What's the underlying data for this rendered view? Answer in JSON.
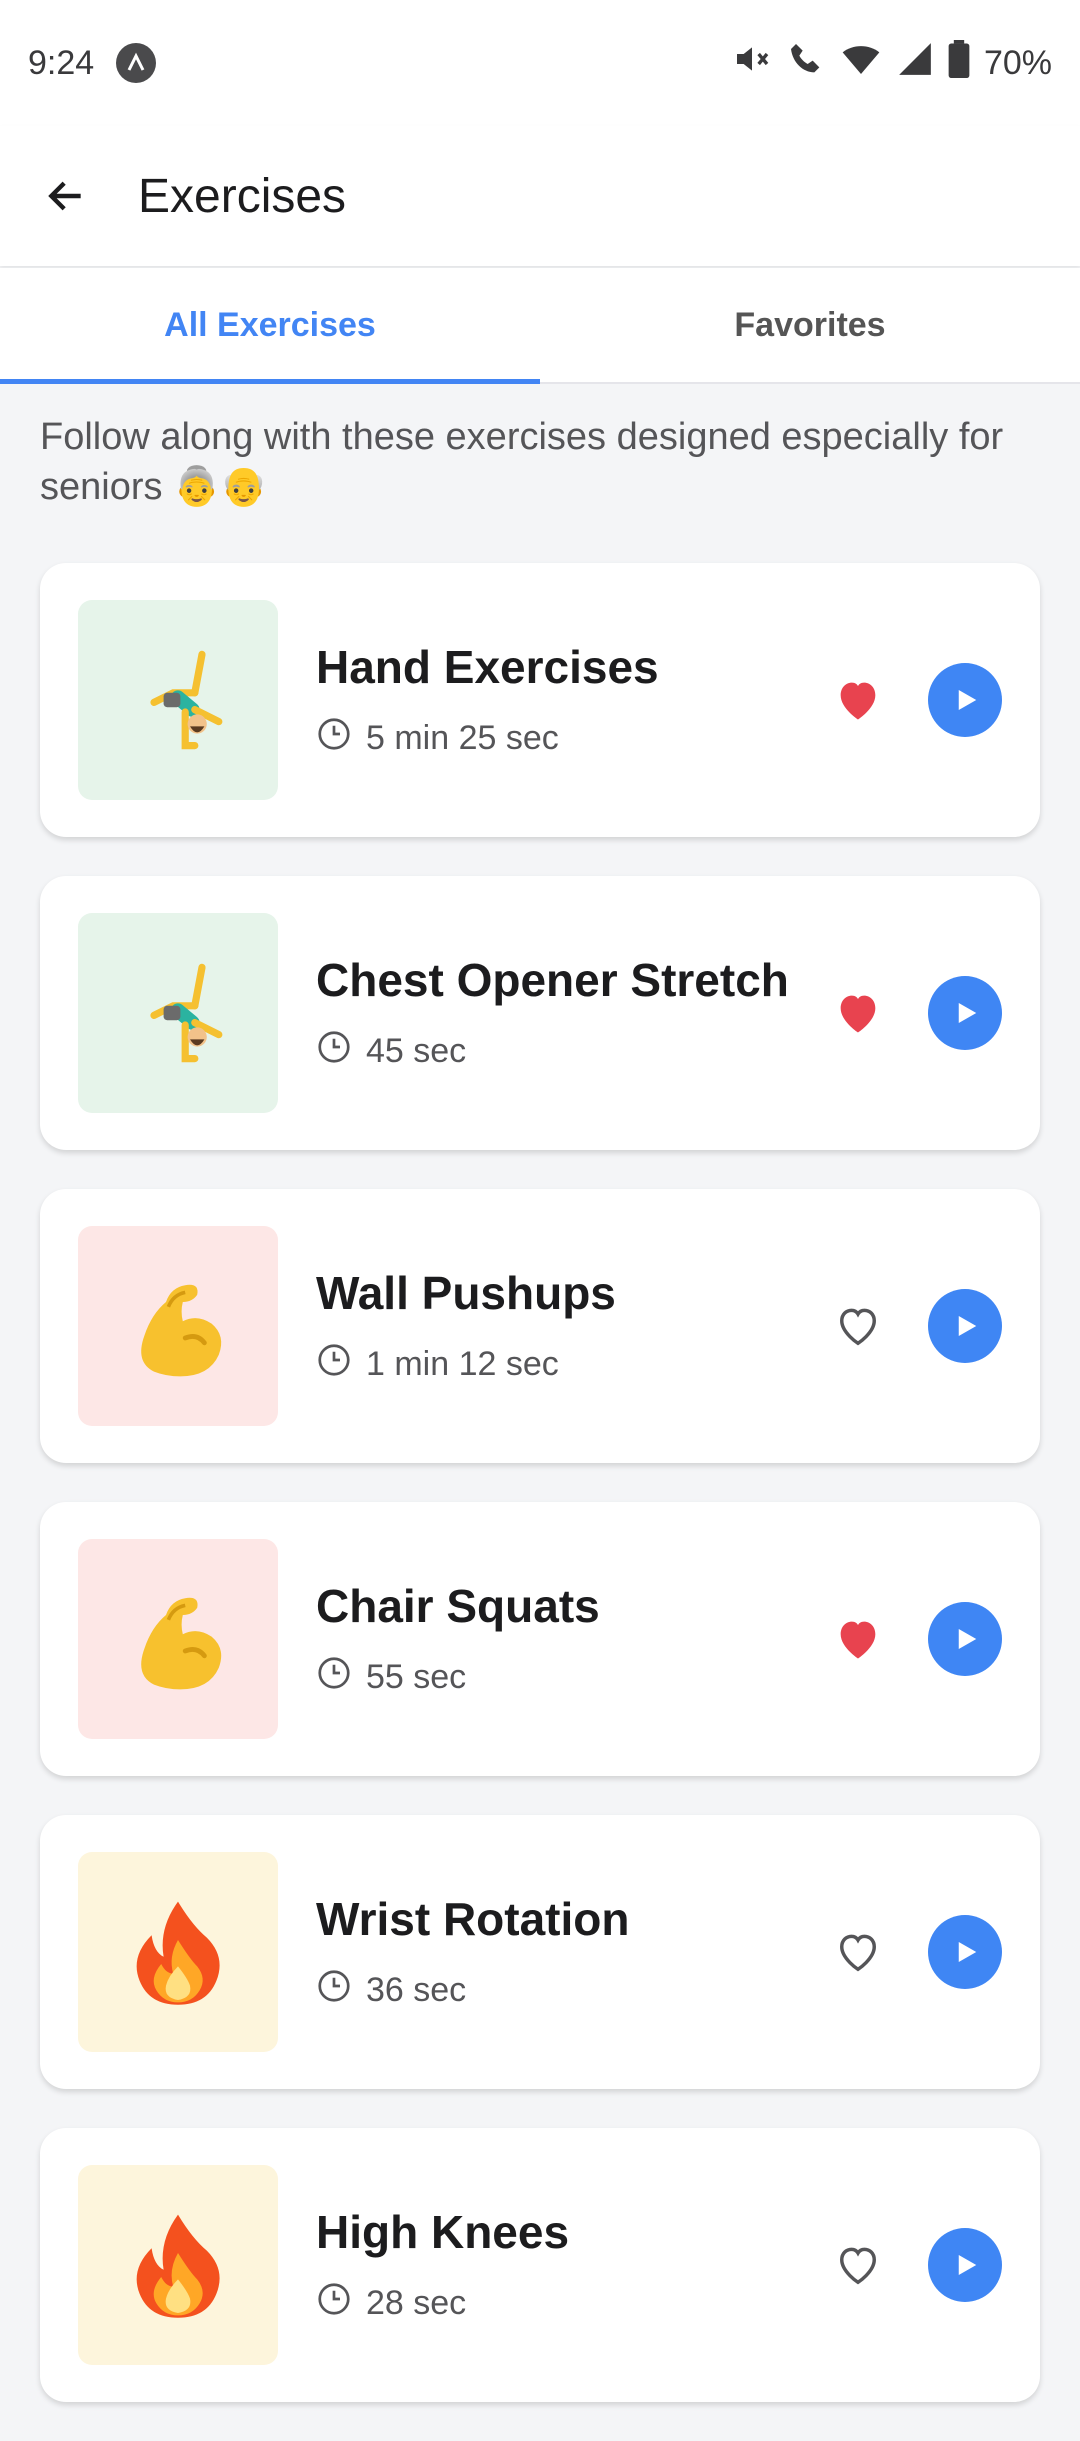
{
  "status_bar": {
    "time": "9:24",
    "battery": "70%"
  },
  "app_bar": {
    "title": "Exercises"
  },
  "tabs": [
    {
      "label": "All Exercises",
      "active": true
    },
    {
      "label": "Favorites",
      "active": false
    }
  ],
  "intro": {
    "text": "Follow along with these exercises designed especially for seniors 👵👴"
  },
  "exercises": [
    {
      "title": "Hand Exercises",
      "duration": "5 min 25 sec",
      "favorite": true,
      "icon": "cartwheel-icon",
      "thumb_bg": "#e6f4ea"
    },
    {
      "title": "Chest Opener Stretch",
      "duration": "45 sec",
      "favorite": true,
      "icon": "cartwheel-icon",
      "thumb_bg": "#e6f4ea"
    },
    {
      "title": "Wall Pushups",
      "duration": "1 min 12 sec",
      "favorite": false,
      "icon": "flexed-bicep-icon",
      "thumb_bg": "#fde7e6"
    },
    {
      "title": "Chair Squats",
      "duration": "55 sec",
      "favorite": true,
      "icon": "flexed-bicep-icon",
      "thumb_bg": "#fde7e6"
    },
    {
      "title": "Wrist Rotation",
      "duration": "36 sec",
      "favorite": false,
      "icon": "fire-icon",
      "thumb_bg": "#fdf5dc"
    },
    {
      "title": "High Knees",
      "duration": "28 sec",
      "favorite": false,
      "icon": "fire-icon",
      "thumb_bg": "#fdf5dc"
    }
  ],
  "colors": {
    "accent": "#4285f4",
    "favorite": "#e8434f",
    "play": "#3f86f4"
  }
}
